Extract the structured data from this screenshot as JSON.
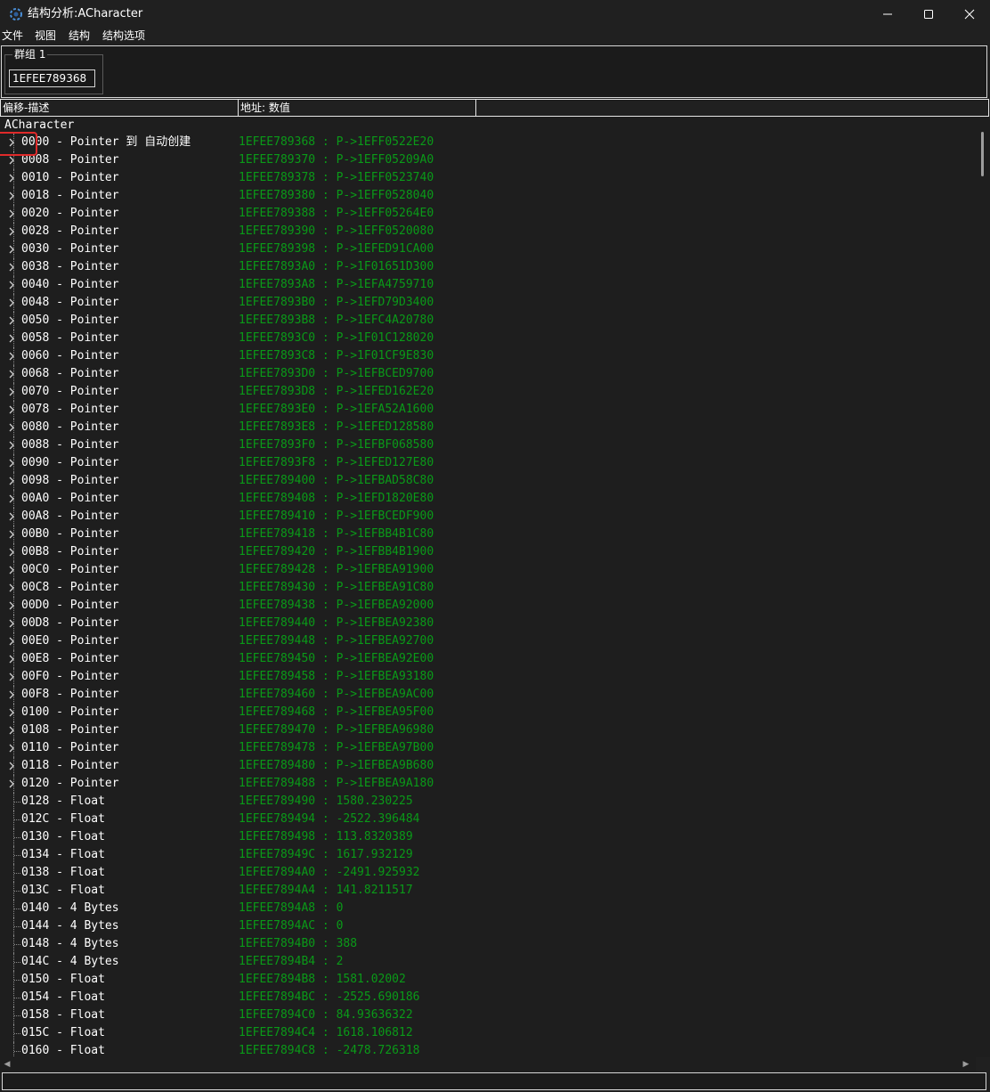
{
  "window": {
    "title": "结构分析:ACharacter",
    "minimize_icon": "minimize-icon",
    "maximize_icon": "maximize-icon",
    "close_icon": "close-icon"
  },
  "menu": [
    "文件",
    "视图",
    "结构",
    "结构选项"
  ],
  "group": {
    "label": "群组 1",
    "address": "1EFEE789368"
  },
  "columns": [
    "偏移-描述",
    "地址: 数值",
    ""
  ],
  "tree": {
    "root": "ACharacter",
    "rows": [
      {
        "desc": "0000 - Pointer 到 自动创建",
        "value": "1EFEE789368 : P->1EFF0522E20",
        "expandable": true
      },
      {
        "desc": "0008 - Pointer",
        "value": "1EFEE789370 : P->1EFF05209A0",
        "expandable": true
      },
      {
        "desc": "0010 - Pointer",
        "value": "1EFEE789378 : P->1EFF0523740",
        "expandable": true
      },
      {
        "desc": "0018 - Pointer",
        "value": "1EFEE789380 : P->1EFF0528040",
        "expandable": true
      },
      {
        "desc": "0020 - Pointer",
        "value": "1EFEE789388 : P->1EFF05264E0",
        "expandable": true
      },
      {
        "desc": "0028 - Pointer",
        "value": "1EFEE789390 : P->1EFF0520080",
        "expandable": true
      },
      {
        "desc": "0030 - Pointer",
        "value": "1EFEE789398 : P->1EFED91CA00",
        "expandable": true
      },
      {
        "desc": "0038 - Pointer",
        "value": "1EFEE7893A0 : P->1F01651D300",
        "expandable": true
      },
      {
        "desc": "0040 - Pointer",
        "value": "1EFEE7893A8 : P->1EFA4759710",
        "expandable": true
      },
      {
        "desc": "0048 - Pointer",
        "value": "1EFEE7893B0 : P->1EFD79D3400",
        "expandable": true
      },
      {
        "desc": "0050 - Pointer",
        "value": "1EFEE7893B8 : P->1EFC4A20780",
        "expandable": true
      },
      {
        "desc": "0058 - Pointer",
        "value": "1EFEE7893C0 : P->1F01C128020",
        "expandable": true
      },
      {
        "desc": "0060 - Pointer",
        "value": "1EFEE7893C8 : P->1F01CF9E830",
        "expandable": true
      },
      {
        "desc": "0068 - Pointer",
        "value": "1EFEE7893D0 : P->1EFBCED9700",
        "expandable": true
      },
      {
        "desc": "0070 - Pointer",
        "value": "1EFEE7893D8 : P->1EFED162E20",
        "expandable": true
      },
      {
        "desc": "0078 - Pointer",
        "value": "1EFEE7893E0 : P->1EFA52A1600",
        "expandable": true
      },
      {
        "desc": "0080 - Pointer",
        "value": "1EFEE7893E8 : P->1EFED128580",
        "expandable": true
      },
      {
        "desc": "0088 - Pointer",
        "value": "1EFEE7893F0 : P->1EFBF068580",
        "expandable": true
      },
      {
        "desc": "0090 - Pointer",
        "value": "1EFEE7893F8 : P->1EFED127E80",
        "expandable": true
      },
      {
        "desc": "0098 - Pointer",
        "value": "1EFEE789400 : P->1EFBAD58C80",
        "expandable": true
      },
      {
        "desc": "00A0 - Pointer",
        "value": "1EFEE789408 : P->1EFD1820E80",
        "expandable": true
      },
      {
        "desc": "00A8 - Pointer",
        "value": "1EFEE789410 : P->1EFBCEDF900",
        "expandable": true
      },
      {
        "desc": "00B0 - Pointer",
        "value": "1EFEE789418 : P->1EFBB4B1C80",
        "expandable": true
      },
      {
        "desc": "00B8 - Pointer",
        "value": "1EFEE789420 : P->1EFBB4B1900",
        "expandable": true
      },
      {
        "desc": "00C0 - Pointer",
        "value": "1EFEE789428 : P->1EFBEA91900",
        "expandable": true
      },
      {
        "desc": "00C8 - Pointer",
        "value": "1EFEE789430 : P->1EFBEA91C80",
        "expandable": true
      },
      {
        "desc": "00D0 - Pointer",
        "value": "1EFEE789438 : P->1EFBEA92000",
        "expandable": true
      },
      {
        "desc": "00D8 - Pointer",
        "value": "1EFEE789440 : P->1EFBEA92380",
        "expandable": true
      },
      {
        "desc": "00E0 - Pointer",
        "value": "1EFEE789448 : P->1EFBEA92700",
        "expandable": true
      },
      {
        "desc": "00E8 - Pointer",
        "value": "1EFEE789450 : P->1EFBEA92E00",
        "expandable": true
      },
      {
        "desc": "00F0 - Pointer",
        "value": "1EFEE789458 : P->1EFBEA93180",
        "expandable": true
      },
      {
        "desc": "00F8 - Pointer",
        "value": "1EFEE789460 : P->1EFBEA9AC00",
        "expandable": true
      },
      {
        "desc": "0100 - Pointer",
        "value": "1EFEE789468 : P->1EFBEA95F00",
        "expandable": true
      },
      {
        "desc": "0108 - Pointer",
        "value": "1EFEE789470 : P->1EFBEA96980",
        "expandable": true
      },
      {
        "desc": "0110 - Pointer",
        "value": "1EFEE789478 : P->1EFBEA97B00",
        "expandable": true
      },
      {
        "desc": "0118 - Pointer",
        "value": "1EFEE789480 : P->1EFBEA9B680",
        "expandable": true
      },
      {
        "desc": "0120 - Pointer",
        "value": "1EFEE789488 : P->1EFBEA9A180",
        "expandable": true
      },
      {
        "desc": "0128 - Float",
        "value": "1EFEE789490 : 1580.230225",
        "expandable": false
      },
      {
        "desc": "012C - Float",
        "value": "1EFEE789494 : -2522.396484",
        "expandable": false
      },
      {
        "desc": "0130 - Float",
        "value": "1EFEE789498 : 113.8320389",
        "expandable": false
      },
      {
        "desc": "0134 - Float",
        "value": "1EFEE78949C : 1617.932129",
        "expandable": false
      },
      {
        "desc": "0138 - Float",
        "value": "1EFEE7894A0 : -2491.925932",
        "expandable": false
      },
      {
        "desc": "013C - Float",
        "value": "1EFEE7894A4 : 141.8211517",
        "expandable": false
      },
      {
        "desc": "0140 - 4 Bytes",
        "value": "1EFEE7894A8 : 0",
        "expandable": false
      },
      {
        "desc": "0144 - 4 Bytes",
        "value": "1EFEE7894AC : 0",
        "expandable": false
      },
      {
        "desc": "0148 - 4 Bytes",
        "value": "1EFEE7894B0 : 388",
        "expandable": false
      },
      {
        "desc": "014C - 4 Bytes",
        "value": "1EFEE7894B4 : 2",
        "expandable": false
      },
      {
        "desc": "0150 - Float",
        "value": "1EFEE7894B8 : 1581.02002",
        "expandable": false
      },
      {
        "desc": "0154 - Float",
        "value": "1EFEE7894BC : -2525.690186",
        "expandable": false
      },
      {
        "desc": "0158 - Float",
        "value": "1EFEE7894C0 : 84.93636322",
        "expandable": false
      },
      {
        "desc": "015C - Float",
        "value": "1EFEE7894C4 : 1618.106812",
        "expandable": false
      },
      {
        "desc": "0160 - Float",
        "value": "1EFEE7894C8 : -2478.726318",
        "expandable": false
      }
    ]
  },
  "colors": {
    "value_text": "#0a9a18",
    "highlight": "#e02a2a"
  }
}
